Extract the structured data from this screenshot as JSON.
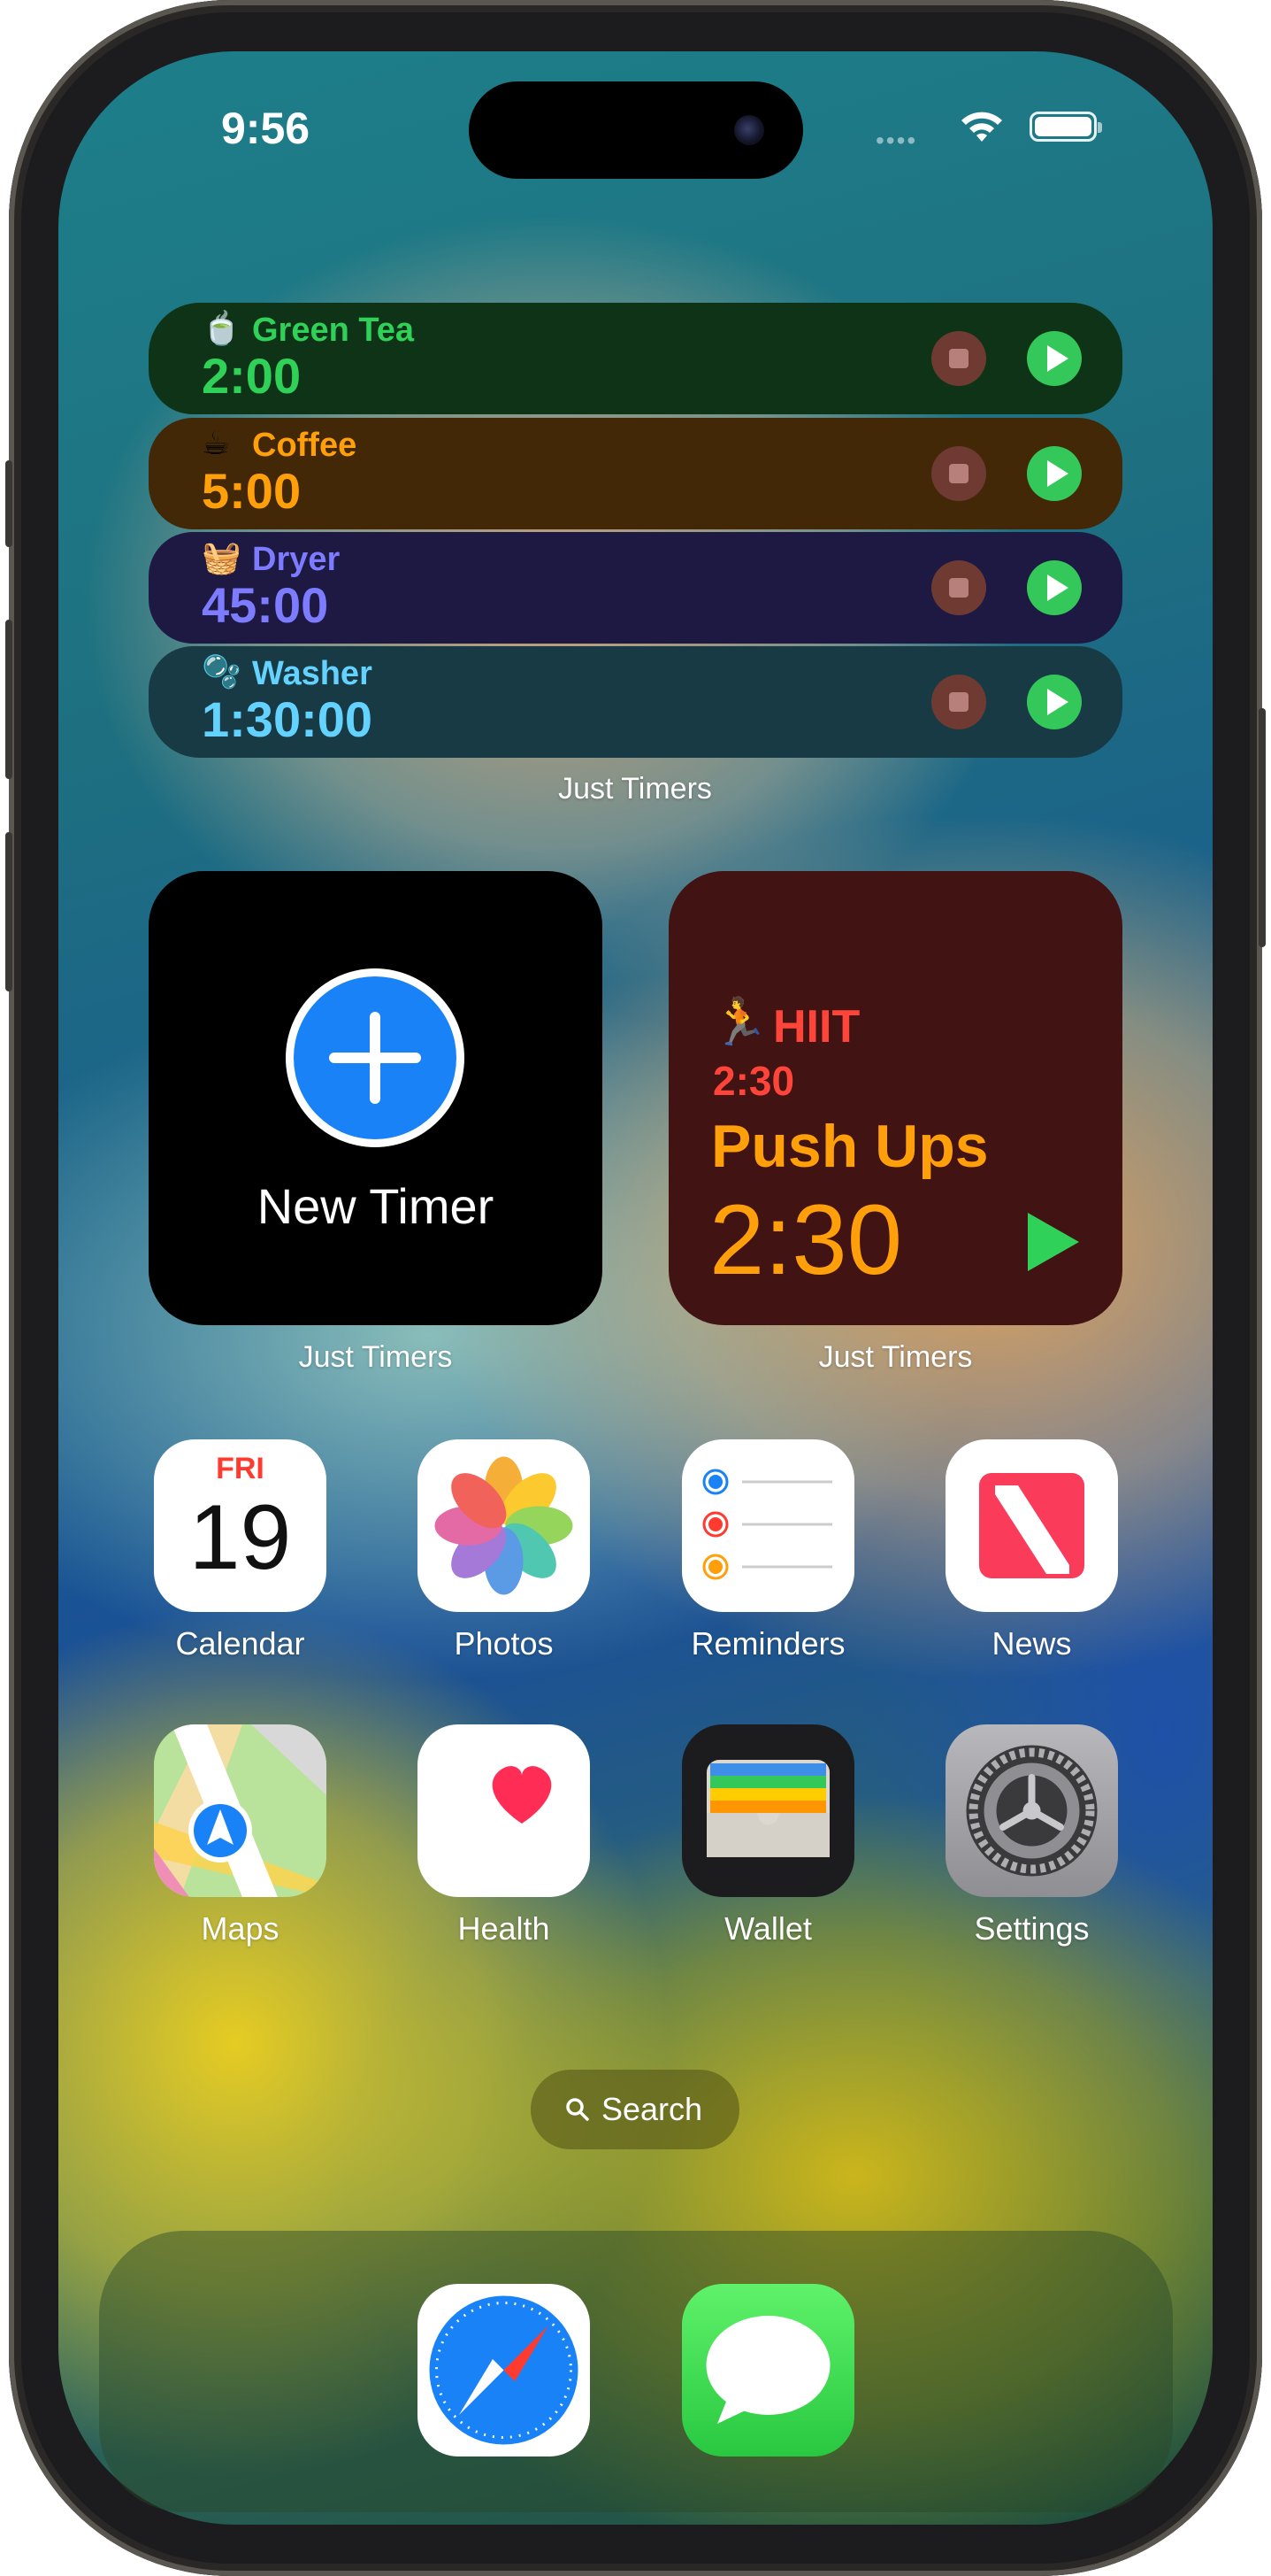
{
  "status_bar": {
    "time": "9:56"
  },
  "timers_widget": {
    "rows": [
      {
        "emoji": "🍵",
        "name": "Green Tea",
        "duration": "2:00",
        "name_color": "#30d158",
        "bg": "#0f3317"
      },
      {
        "emoji": "☕",
        "name": "Coffee",
        "duration": "5:00",
        "name_color": "#ff9f0a",
        "bg": "#432808"
      },
      {
        "emoji": "🧺",
        "name": "Dryer",
        "duration": "45:00",
        "name_color": "#5e5ce6",
        "bg": "#1d1942"
      },
      {
        "emoji": "🫧",
        "name": "Washer",
        "duration": "1:30:00",
        "name_color": "#64d2ff",
        "bg": "#183a45"
      }
    ],
    "caption": "Just Timers"
  },
  "new_timer_widget": {
    "label": "New Timer",
    "caption": "Just Timers"
  },
  "hiit_widget": {
    "emoji": "🏃",
    "title": "HIIT",
    "total_time": "2:30",
    "current_step": "Push Ups",
    "step_time": "2:30",
    "caption": "Just Timers"
  },
  "apps": {
    "calendar": {
      "label": "Calendar",
      "weekday": "FRI",
      "day": "19"
    },
    "photos": {
      "label": "Photos"
    },
    "reminders": {
      "label": "Reminders"
    },
    "news": {
      "label": "News"
    },
    "maps": {
      "label": "Maps"
    },
    "health": {
      "label": "Health"
    },
    "wallet": {
      "label": "Wallet"
    },
    "settings": {
      "label": "Settings"
    }
  },
  "search": {
    "label": "Search"
  },
  "dock": {
    "apps": [
      "Safari",
      "Messages"
    ]
  }
}
